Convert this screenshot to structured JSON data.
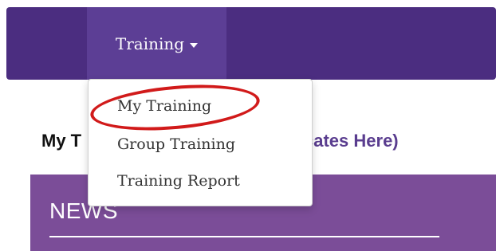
{
  "navbar": {
    "menu_label": "Training",
    "accent_color": "#4b2d80"
  },
  "dropdown": {
    "items": [
      {
        "label": "My Training"
      },
      {
        "label": "Group Training"
      },
      {
        "label": "Training Report"
      }
    ],
    "highlighted_item": "My Training",
    "highlight_color": "#d11a1a"
  },
  "main": {
    "heading_start": "My T",
    "heading_link_fragment": "tificates Here)"
  },
  "news": {
    "title": "NEWS",
    "panel_color": "#7b4d98"
  }
}
